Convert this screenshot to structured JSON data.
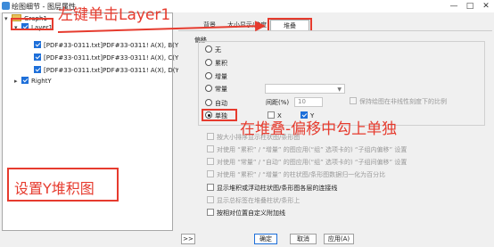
{
  "window": {
    "title": "绘图细节 - 图层属性",
    "minimize": "—",
    "maximize": "□",
    "close": "✕"
  },
  "tree": {
    "root_label": "Graph1",
    "layer_label": "Layer1",
    "plot_items": [
      "[PDF#33-0311.txt]PDF#33-0311! A(X), B(Y",
      "[PDF#33-0311.txt]PDF#33-0311! A(X), C(Y",
      "[PDF#33-0311.txt]PDF#33-0311! A(X), D(Y"
    ],
    "right_y_label": "RightY"
  },
  "tabs": [
    "背景",
    "大小",
    "显示/速度",
    "堆叠"
  ],
  "stack": {
    "group_title": "偏移",
    "options": [
      "无",
      "累积",
      "增量",
      "常量",
      "自动",
      "单独"
    ],
    "selected_option": "单独",
    "gap_label": "间距(%)",
    "gap_value": "10",
    "keep_ratio_label": "保持绘图在非线性刻度下的比例",
    "x_label": "X",
    "y_label": "Y"
  },
  "options": [
    "按大小排序显示柱状图/条形图",
    "对使用 “累积” / “增量” 的图应用(“组” 选项卡的) “子组内偏移” 设置",
    "对使用 “常量” / “自动” 的图应用(“组” 选项卡的) “子组间偏移” 设置",
    "对使用 “累积” / “增量” 的柱状图/条形图数据归一化为百分比",
    "显示堆积或浮动柱状图/条形图各层的连接线",
    "显示总标签在堆叠柱状/条形上",
    "按相对位置自定义附加线"
  ],
  "footer": {
    "expand": ">>",
    "ok": "确定",
    "cancel": "取消",
    "apply": "应用(A)"
  },
  "annotations": {
    "left_click": "左键单击Layer1",
    "set_y_stack": "设置Y堆积图",
    "check_single": "在堆叠-偏移中勾上单独"
  },
  "colors": {
    "annotation_red": "#e63b2e",
    "accent_blue": "#1e6fd9"
  }
}
